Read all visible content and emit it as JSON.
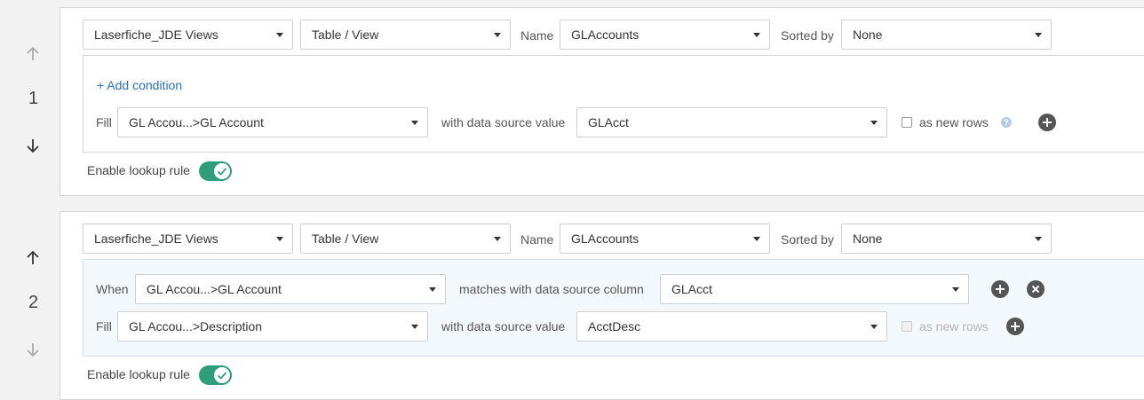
{
  "rules": [
    {
      "number": "1",
      "datasource": "Laserfiche_JDE Views",
      "object_type": "Table / View",
      "name_label": "Name",
      "name_value": "GLAccounts",
      "sorted_label": "Sorted by",
      "sorted_value": "None",
      "add_condition": "+ Add condition",
      "fill_label": "Fill",
      "fill_field": "GL Accou...>GL Account",
      "with_label": "with data source value",
      "with_value": "GLAcct",
      "as_new_rows": "as new rows",
      "enable_label": "Enable lookup rule"
    },
    {
      "number": "2",
      "datasource": "Laserfiche_JDE Views",
      "object_type": "Table / View",
      "name_label": "Name",
      "name_value": "GLAccounts",
      "sorted_label": "Sorted by",
      "sorted_value": "None",
      "when_label": "When",
      "when_field": "GL Accou...>GL Account",
      "matches_label": "matches with data source column",
      "matches_value": "GLAcct",
      "fill_label": "Fill",
      "fill_field": "GL Accou...>Description",
      "with_label": "with data source value",
      "with_value": "AcctDesc",
      "as_new_rows": "as new rows",
      "enable_label": "Enable lookup rule"
    }
  ],
  "colors": {
    "toggle_on": "#2e9e78",
    "link": "#2a6fb8",
    "condition_bg": "#f3f8fd"
  }
}
